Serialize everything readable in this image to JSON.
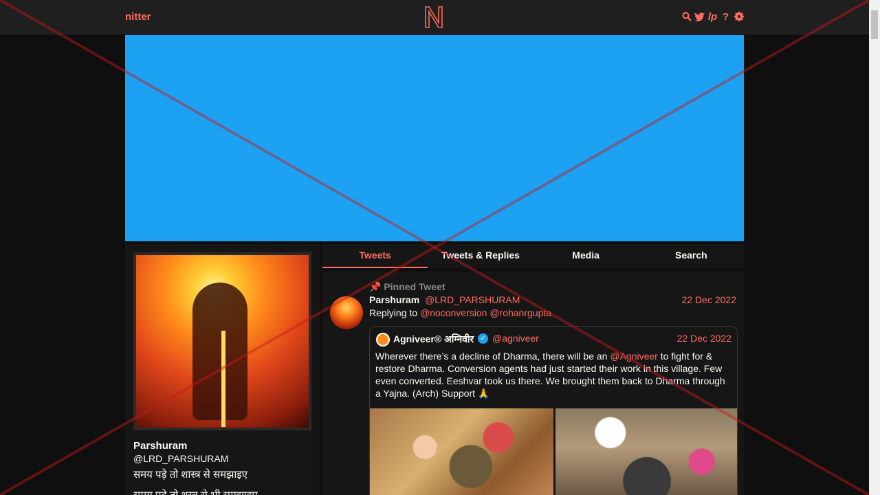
{
  "nav": {
    "brand": "nitter",
    "logo_letter": "N",
    "icons": [
      "search-icon",
      "twitter-bird-icon",
      "lp-icon",
      "help-icon",
      "gear-icon"
    ],
    "lp_text": "lp",
    "help_text": "?"
  },
  "colors": {
    "accent": "#ff6c60",
    "banner": "#1da1f2",
    "background": "#0f0f0f",
    "panel": "#161616",
    "verified": "#1da1f2"
  },
  "profile": {
    "name": "Parshuram",
    "handle": "@LRD_PARSHURAM",
    "bio_line1": "समय पड़े तो शास्त्र से समझाइए",
    "bio_line2": "समय पड़े तो शस्त्र से भी समझाइए"
  },
  "tabs": [
    {
      "label": "Tweets",
      "active": true
    },
    {
      "label": "Tweets & Replies",
      "active": false
    },
    {
      "label": "Media",
      "active": false
    },
    {
      "label": "Search",
      "active": false
    }
  ],
  "tweet": {
    "pinned_label": "Pinned Tweet",
    "fullname": "Parshuram",
    "username": "@LRD_PARSHURAM",
    "date": "22 Dec 2022",
    "replying_to_label": "Replying to",
    "replying_to": [
      "@noconversion",
      "@rohanrgupta"
    ],
    "quote": {
      "fullname": "Agniveer® अग्निवीर",
      "username": "@agniveer",
      "date": "22 Dec 2022",
      "text_part1": "Wherever there’s a decline of Dharma, there will be an ",
      "text_mention": "@Agniveer",
      "text_part2": " to fight for & restore Dharma. Conversion agents had just started their work in this village. Few even converted. Eeshvar took us there. We brought them back to Dharma through a Yajna. (Arch) Support 🙏"
    }
  }
}
